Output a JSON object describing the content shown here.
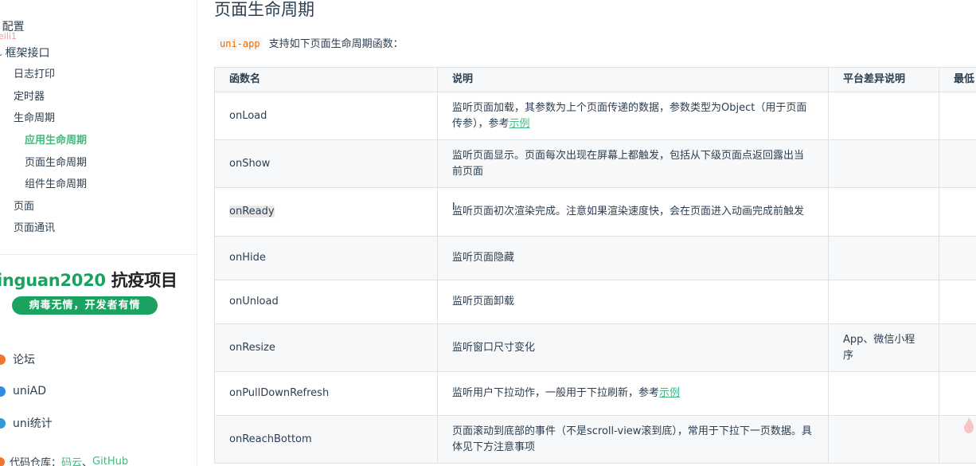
{
  "sidebar": {
    "watermark": "eili1",
    "config": "配置",
    "framework": "框架接口",
    "items": [
      {
        "label": "日志打印"
      },
      {
        "label": "定时器"
      },
      {
        "label": "生命周期"
      },
      {
        "label": "应用生命周期"
      },
      {
        "label": "页面生命周期"
      },
      {
        "label": "组件生命周期"
      },
      {
        "label": "页面"
      },
      {
        "label": "页面通讯"
      }
    ],
    "banner_title_green": "inguan2020",
    "banner_title_dark": " 抗疫项目",
    "banner_subtitle": "病毒无情，开发者有情",
    "ecosystem": [
      {
        "label": "论坛",
        "icon": "forum-icon"
      },
      {
        "label": "uniAD",
        "icon": "uniad-icon"
      },
      {
        "label": "uni统计",
        "icon": "stats-icon"
      }
    ],
    "repo_label": "代码仓库：",
    "repo_link1": "码云",
    "repo_sep": "、",
    "repo_link2": "GitHub"
  },
  "main": {
    "title": "页面生命周期",
    "intro_code": "uni-app",
    "intro_text": "支持如下页面生命周期函数：",
    "table": {
      "headers": [
        "函数名",
        "说明",
        "平台差异说明",
        "最低"
      ],
      "rows": [
        {
          "name": "onLoad",
          "desc": "监听页面加载，其参数为上个页面传递的数据，参数类型为Object（用于页面传参），参考",
          "link": "示例",
          "platform": ""
        },
        {
          "name": "onShow",
          "desc": "监听页面显示。页面每次出现在屏幕上都触发，包括从下级页面点返回露出当前页面",
          "link": "",
          "platform": ""
        },
        {
          "name": "onReady",
          "desc": "监听页面初次渲染完成。注意如果渲染速度快，会在页面进入动画完成前触发",
          "link": "",
          "platform": ""
        },
        {
          "name": "onHide",
          "desc": "监听页面隐藏",
          "link": "",
          "platform": ""
        },
        {
          "name": "onUnload",
          "desc": "监听页面卸载",
          "link": "",
          "platform": ""
        },
        {
          "name": "onResize",
          "desc": "监听窗口尺寸变化",
          "link": "",
          "platform": "App、微信小程序"
        },
        {
          "name": "onPullDownRefresh",
          "desc": "监听用户下拉动作，一般用于下拉刷新，参考",
          "link": "示例",
          "platform": ""
        },
        {
          "name": "onReachBottom",
          "desc": "页面滚动到底部的事件（不是scroll-view滚到底），常用于下拉下一页数据。具体见下方注意事项",
          "link": "",
          "platform": ""
        }
      ]
    }
  },
  "colors": {
    "accent": "#42b983",
    "banner_green": "#1aa260",
    "code": "#e96900"
  }
}
